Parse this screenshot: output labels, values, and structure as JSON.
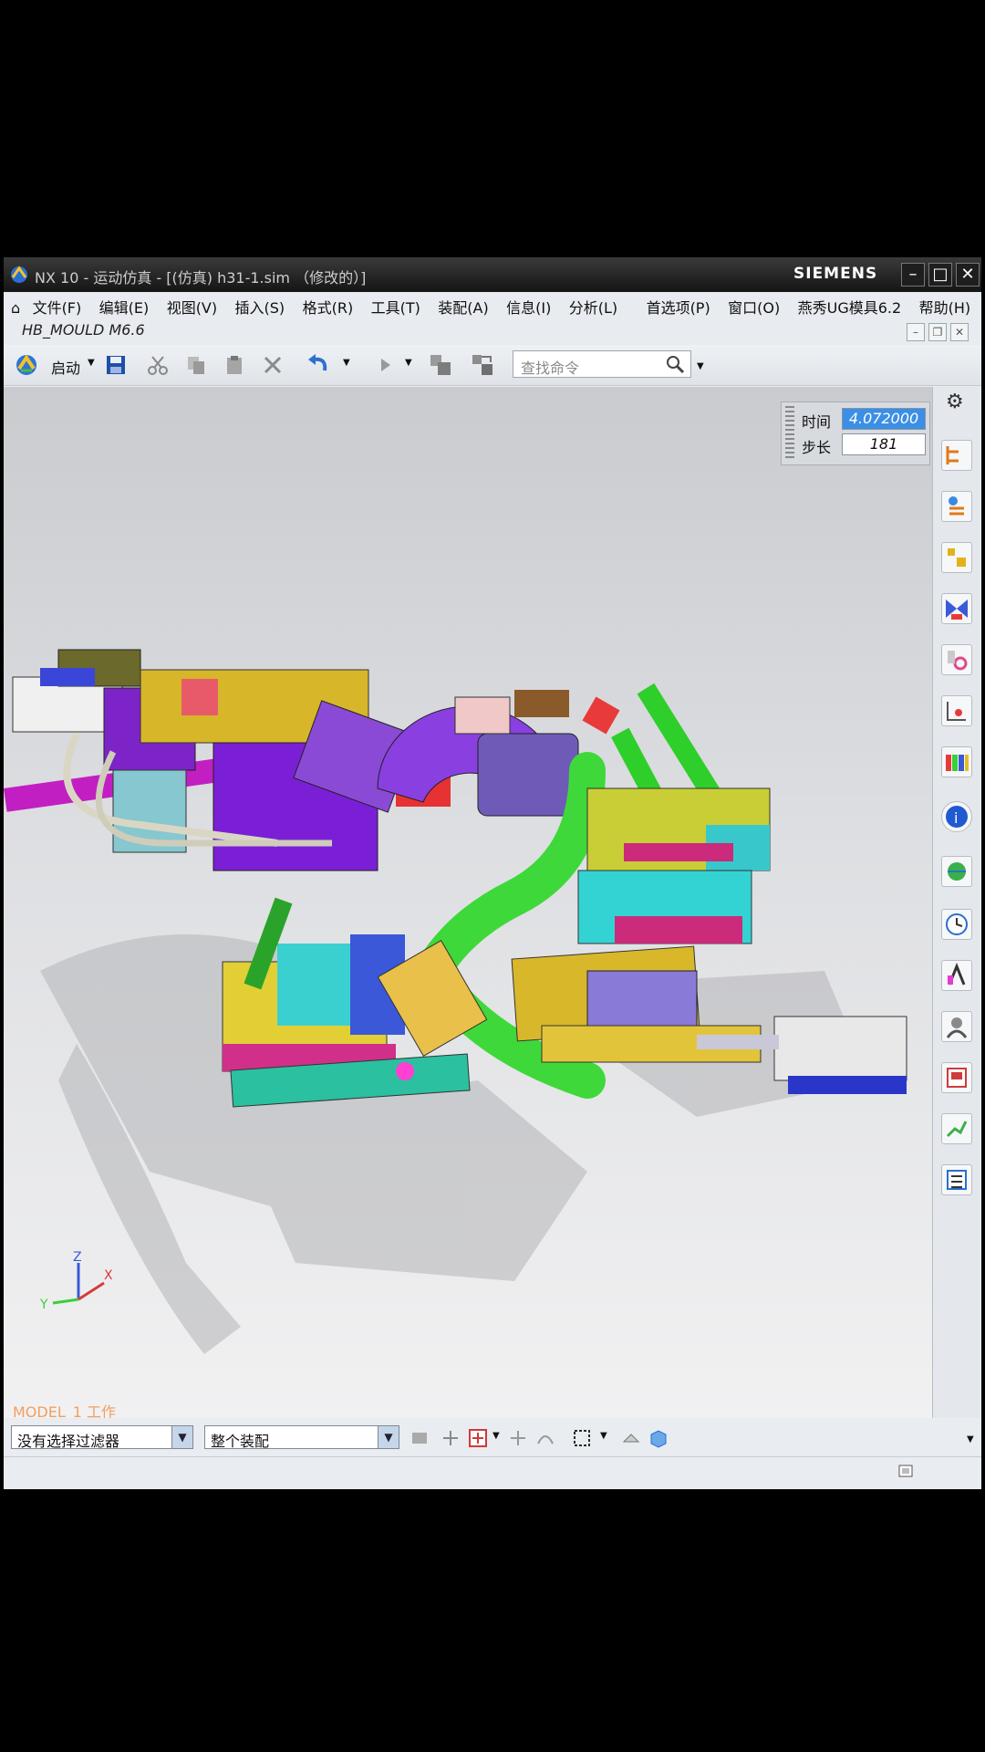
{
  "window": {
    "title": "NX 10 - 运动仿真 - [(仿真) h31-1.sim （修改的）]",
    "brand": "SIEMENS"
  },
  "menu": {
    "items": [
      "文件(F)",
      "编辑(E)",
      "视图(V)",
      "插入(S)",
      "格式(R)",
      "工具(T)",
      "装配(A)",
      "信息(I)",
      "分析(L)",
      "首选项(P)",
      "窗口(O)",
      "燕秀UG模具6.2",
      "帮助(H)"
    ],
    "second_row": "HB_MOULD M6.6"
  },
  "toolbar": {
    "start_label": "启动",
    "search_placeholder": "查找命令"
  },
  "animation": {
    "time_label": "时间",
    "time_value": "4.072000",
    "step_label": "步长",
    "step_value": "181"
  },
  "viewport": {
    "model_label": "MODEL_1 工作",
    "triad": {
      "z": "Z",
      "x": "X",
      "y": "Y"
    }
  },
  "status": {
    "filter_value": "没有选择过滤器",
    "scope_value": "整个装配"
  },
  "colors": {
    "accent_selection": "#3b8fe6",
    "viewport_border": "#e8a86a"
  }
}
